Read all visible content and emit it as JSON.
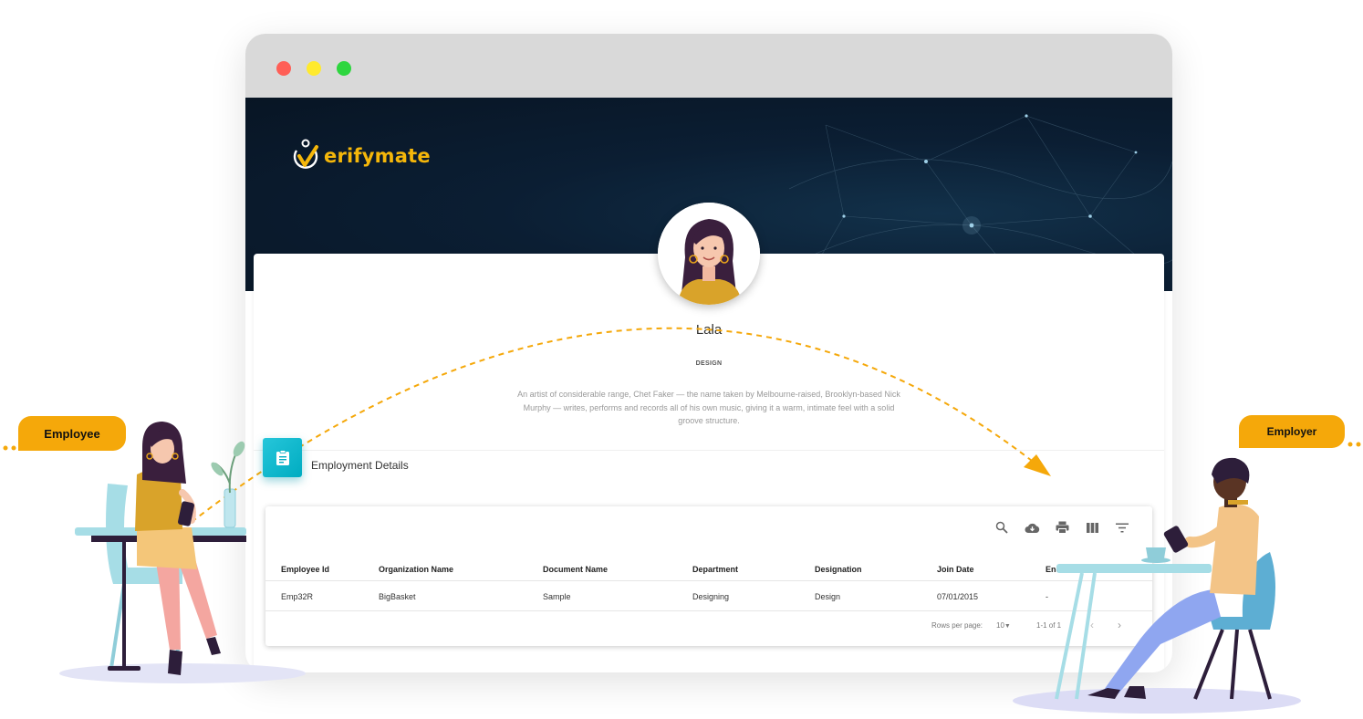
{
  "brand": {
    "name": "erifymate",
    "accent": "#f5b70a"
  },
  "profile": {
    "name": "Lala",
    "department": "DESIGN",
    "bio": "An artist of considerable range, Chet Faker — the name taken by Melbourne-raised, Brooklyn-based Nick Murphy — writes, performs and records all of his own music, giving it a warm, intimate feel with a solid groove structure."
  },
  "employment": {
    "title": "Employment Details",
    "toolbar_icons": [
      "search-icon",
      "cloud-download-icon",
      "print-icon",
      "view-column-icon",
      "filter-icon"
    ],
    "columns": [
      "Employee Id",
      "Organization Name",
      "Document Name",
      "Department",
      "Designation",
      "Join Date",
      "End Date"
    ],
    "rows": [
      [
        "Emp32R",
        "BigBasket",
        "Sample",
        "Designing",
        "Design",
        "07/01/2015",
        "-"
      ]
    ],
    "pagination": {
      "rows_per_page_label": "Rows per page:",
      "rows_per_page_value": "10",
      "range": "1-1 of 1"
    }
  },
  "labels": {
    "employee": "Employee",
    "employer": "Employer"
  },
  "colors": {
    "header_dark": "#0b1e33",
    "teal": "#00acc1",
    "tag_orange": "#f5a80a",
    "window_red": "#ff5f57",
    "window_yellow": "#ffea2e",
    "window_green": "#2ed63f"
  }
}
